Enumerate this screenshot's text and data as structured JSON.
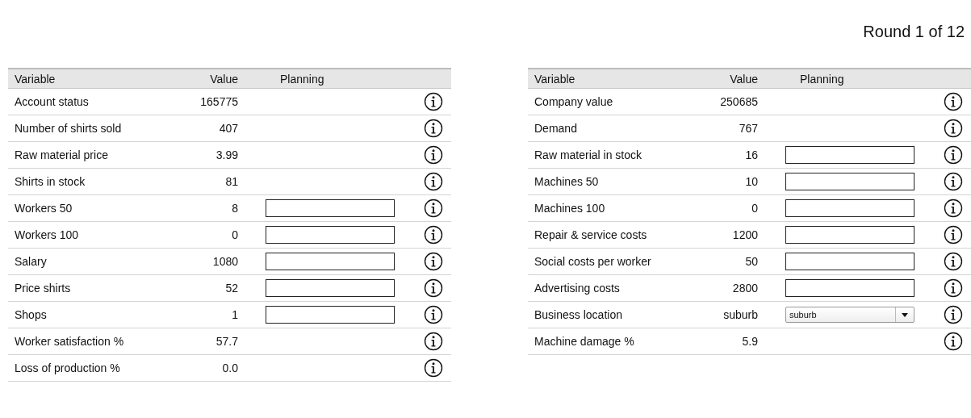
{
  "round_label": "Round 1 of 12",
  "tables": [
    {
      "columns": [
        "Variable",
        "Value",
        "Planning"
      ],
      "rows": [
        {
          "variable": "Account status",
          "value": "165775",
          "kind": "text"
        },
        {
          "variable": "Number of shirts sold",
          "value": "407",
          "kind": "text"
        },
        {
          "variable": "Raw material price",
          "value": "3.99",
          "kind": "text"
        },
        {
          "variable": "Shirts in stock",
          "value": "81",
          "kind": "text"
        },
        {
          "variable": "Workers 50",
          "value": "8",
          "kind": "input"
        },
        {
          "variable": "Workers 100",
          "value": "0",
          "kind": "input"
        },
        {
          "variable": "Salary",
          "value": "1080",
          "kind": "input"
        },
        {
          "variable": "Price shirts",
          "value": "52",
          "kind": "input"
        },
        {
          "variable": "Shops",
          "value": "1",
          "kind": "input"
        },
        {
          "variable": "Worker satisfaction %",
          "value": "57.7",
          "kind": "text"
        },
        {
          "variable": "Loss of production %",
          "value": "0.0",
          "kind": "text"
        }
      ]
    },
    {
      "columns": [
        "Variable",
        "Value",
        "Planning"
      ],
      "rows": [
        {
          "variable": "Company value",
          "value": "250685",
          "kind": "text"
        },
        {
          "variable": "Demand",
          "value": "767",
          "kind": "text"
        },
        {
          "variable": "Raw material in stock",
          "value": "16",
          "kind": "input"
        },
        {
          "variable": "Machines 50",
          "value": "10",
          "kind": "input"
        },
        {
          "variable": "Machines 100",
          "value": "0",
          "kind": "input"
        },
        {
          "variable": "Repair & service costs",
          "value": "1200",
          "kind": "input"
        },
        {
          "variable": "Social costs per worker",
          "value": "50",
          "kind": "input"
        },
        {
          "variable": "Advertising costs",
          "value": "2800",
          "kind": "input"
        },
        {
          "variable": "Business location",
          "value": "suburb",
          "kind": "select",
          "planning": "suburb"
        },
        {
          "variable": "Machine damage %",
          "value": "5.9",
          "kind": "text"
        }
      ]
    }
  ]
}
